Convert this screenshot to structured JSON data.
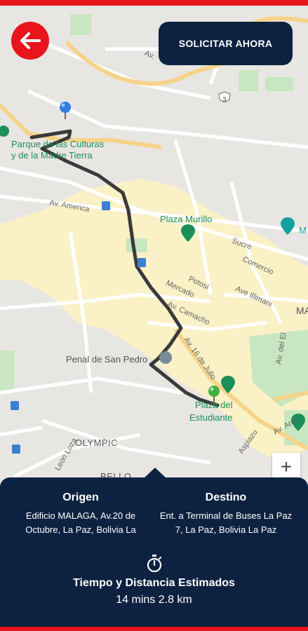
{
  "header": {
    "request_button_label": "SOLICITAR AHORA"
  },
  "map": {
    "labels": {
      "park": "Parque de las Culturas",
      "park2": "y de la Madre Tierra",
      "av_america": "Av. America",
      "plaza_murillo": "Plaza Murillo",
      "sucre": "Sucre",
      "potosi": "Potosi",
      "mercado": "Mercado",
      "comercio": "Comercio",
      "ave_illimani": "Ave Illimani",
      "av_camacho": "Av. Camacho",
      "av_16_julio": "Av. 16 de Julio",
      "penal": "Penal de San Pedro",
      "plaza_est1": "Plaza del",
      "plaza_est2": "Estudiante",
      "olympic": "OLYMPIC",
      "bello": "BELLO",
      "leon_loza": "Leon Loza",
      "av_arce": "Av. Arce",
      "aspiazu": "Aspiazu",
      "av_el": "Av. del El",
      "m_right": "M",
      "ma_right": "MA",
      "route_3": "3",
      "av_top": "Av."
    }
  },
  "panel": {
    "origin_title": "Origen",
    "origin_text": "Edificio MALAGA, Av.20 de Octubre, La Paz, Bolivia La",
    "dest_title": "Destino",
    "dest_text": "Ent. a Terminal de Buses La Paz 7, La Paz, Bolivia La Paz",
    "estimate_title": "Tiempo y Distancia Estimados",
    "estimate_value": "14 mins 2.8 km"
  },
  "colors": {
    "accent_red": "#e8151d",
    "navy": "#0d2240",
    "route": "#3a3a3a",
    "park_green": "#c8e6c1",
    "label_green": "#1a8f5a",
    "highway_yellow": "#f6d38a"
  }
}
